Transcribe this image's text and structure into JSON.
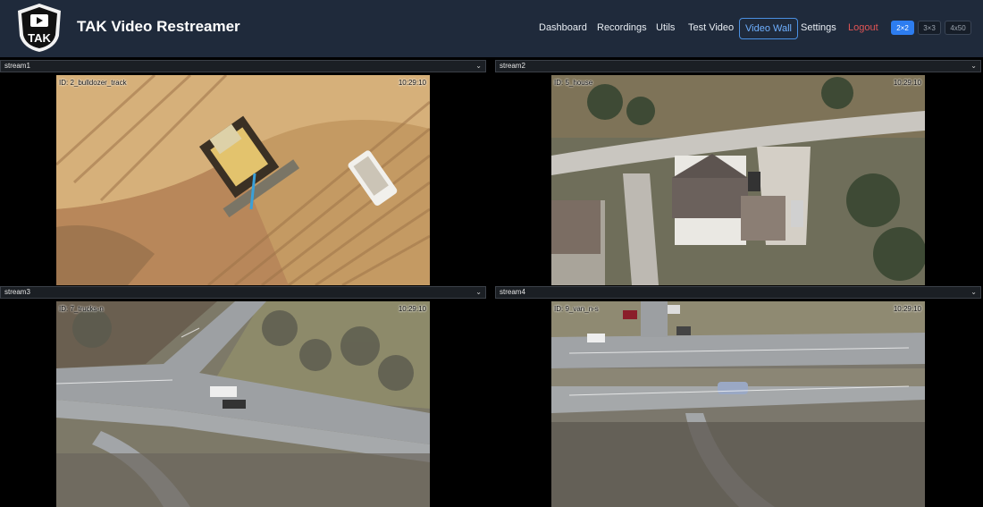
{
  "app": {
    "title": "TAK Video Restreamer",
    "logo_text": "TAK"
  },
  "nav": {
    "dashboard": "Dashboard",
    "recordings": "Recordings",
    "utils": "Utils",
    "test_video": "Test Video",
    "video_wall": "Video Wall",
    "settings": "Settings",
    "logout": "Logout"
  },
  "layout_options": [
    "2×2",
    "3×3",
    "4x50"
  ],
  "selected_layout": "2×2",
  "colors": {
    "navbar": "#1f2a3b",
    "accent": "#2d7df0",
    "logout": "#e25555"
  },
  "streams": [
    {
      "select_value": "stream1",
      "overlay_id": "ID: 2_bulldozer_track",
      "overlay_time": "10:29:10"
    },
    {
      "select_value": "stream2",
      "overlay_id": "ID: 5_house",
      "overlay_time": "10:29:10"
    },
    {
      "select_value": "stream3",
      "overlay_id": "ID: 7_trucks-n",
      "overlay_time": "10:29:10"
    },
    {
      "select_value": "stream4",
      "overlay_id": "ID: 9_van_n-s",
      "overlay_time": "10:29:10"
    }
  ]
}
